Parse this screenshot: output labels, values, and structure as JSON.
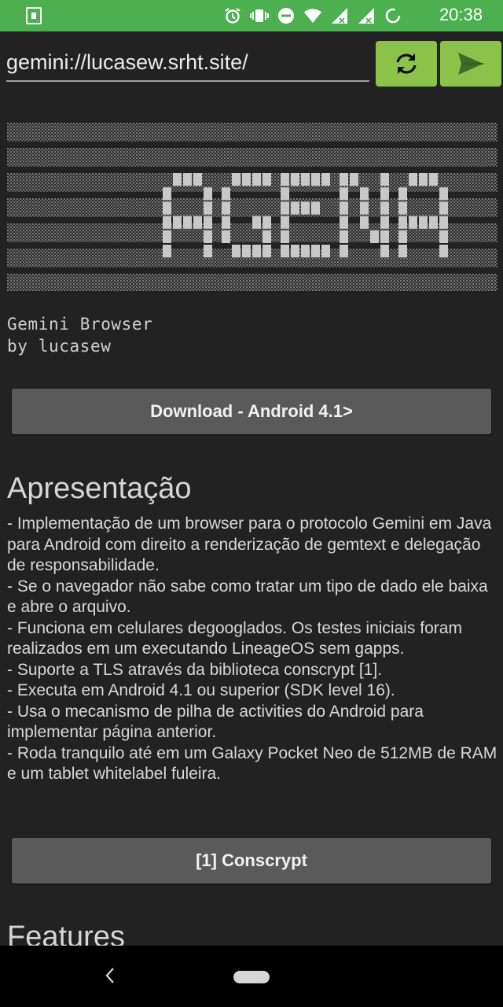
{
  "status_bar": {
    "time": "20:38"
  },
  "address_bar": {
    "url": "gemini://lucasew.srht.site/"
  },
  "banner": {
    "letters": [
      "A",
      "G",
      "E",
      "N",
      "A"
    ],
    "pattern_fg": "#c8c8c8",
    "pattern_bg": "#3a3a3a"
  },
  "intro": {
    "line1": "Gemini Browser",
    "line2": "by lucasew"
  },
  "download_button": {
    "label": "Download - Android 4.1>"
  },
  "section1": {
    "heading": "Apresentação",
    "items": [
      "- Implementação de um browser para o protocolo Gemini em Java para Android com direito a renderização de gemtext e delegação de responsabilidade.",
      "- Se o navegador não sabe como tratar um tipo de dado ele baixa e abre o arquivo.",
      "- Funciona em celulares degooglados. Os testes iniciais foram realizados em um executando LineageOS sem gapps.",
      "- Suporte a TLS através da biblioteca conscrypt [1].",
      "- Executa em Android 4.1 ou superior (SDK level 16).",
      "- Usa o mecanismo de pilha de activities do Android para implementar página anterior.",
      "- Roda tranquilo até em um Galaxy Pocket Neo de 512MB de RAM e um tablet whitelabel fuleira."
    ]
  },
  "conscrypt_button": {
    "label": "[1] Conscrypt"
  },
  "section2": {
    "heading": "Features"
  },
  "colors": {
    "accent": "#4caf50",
    "button_green": "#8bc34a",
    "background": "#222222",
    "link_button": "#5a5a5a"
  }
}
